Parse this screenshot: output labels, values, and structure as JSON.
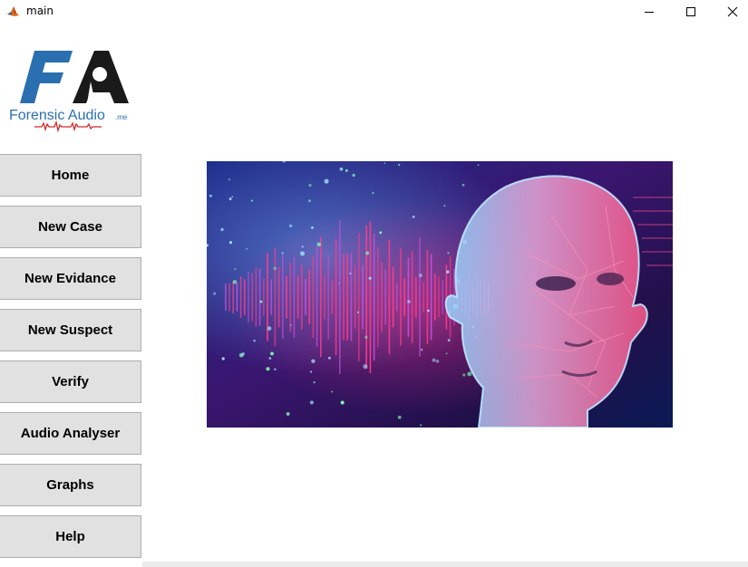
{
  "window": {
    "title": "main",
    "controls": {
      "minimize_icon": "minimize-icon",
      "maximize_icon": "maximize-icon",
      "close_icon": "close-icon"
    }
  },
  "logo": {
    "letters": "FA",
    "text": "Forensic Audio",
    "suffix": ".me",
    "colors": {
      "primary": "#2a6fb0",
      "dark": "#1a1a1a",
      "wave": "#d42a2a"
    }
  },
  "nav": {
    "items": [
      {
        "label": "Home"
      },
      {
        "label": "New Case"
      },
      {
        "label": "New Evidance"
      },
      {
        "label": "New Suspect"
      },
      {
        "label": "Verify"
      },
      {
        "label": "Audio Analyser"
      },
      {
        "label": "Graphs"
      },
      {
        "label": "Help"
      }
    ]
  },
  "colors": {
    "button_bg": "#e1e1e1",
    "button_border": "#adadad",
    "accent_pink": "#ff3c8c",
    "accent_blue": "#3a8cff"
  }
}
